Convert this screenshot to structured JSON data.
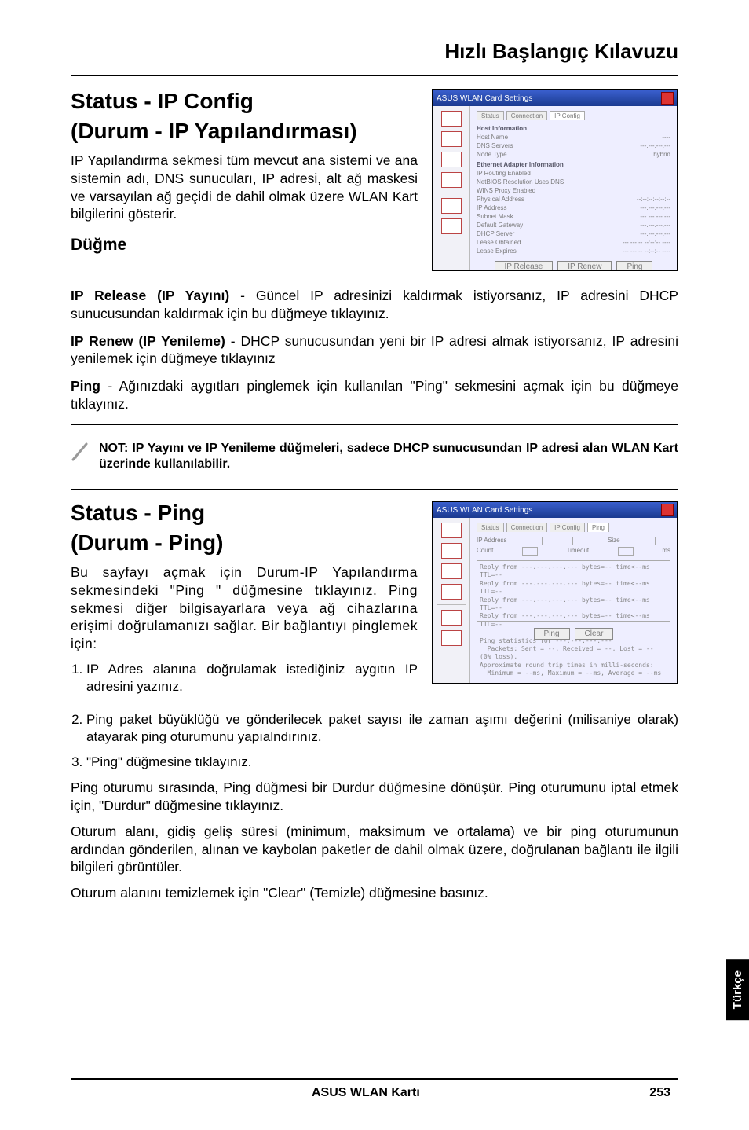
{
  "doc": {
    "header_title": "Hızlı Başlangıç Kılavuzu",
    "footer_product": "ASUS WLAN Kartı",
    "footer_page": "253",
    "side_lang_tab": "Türkçe"
  },
  "section1": {
    "title_line1": "Status - IP Config",
    "title_line2": "(Durum - IP Yapılandırması)",
    "intro": "IP Yapılandırma sekmesi tüm mevcut ana sistemi ve ana sistemin adı, DNS sunucuları, IP adresi, alt ağ maskesi ve varsayılan ağ geçidi de dahil olmak üzere WLAN Kart bilgilerini gösterir.",
    "buttons_heading": "Düğme",
    "b1_name": "IP Release (IP Yayını)",
    "b1_text": " - Güncel IP adresinizi kaldırmak istiyorsanız, IP adresini DHCP sunucusundan kaldırmak için bu düğmeye tıklayınız.",
    "b2_name": "IP Renew (IP Yenileme)",
    "b2_text": " - DHCP sunucusundan yeni bir IP adresi almak istiyorsanız, IP adresini yenilemek için düğmeye tıklayınız",
    "b3_name": "Ping",
    "b3_text": " - Ağınızdaki aygıtları pinglemek için kullanılan \"Ping\" sekmesini açmak için bu düğmeye tıklayınız.",
    "note": "NOT: IP Yayını ve IP Yenileme düğmeleri, sadece DHCP sunucusundan IP adresi alan WLAN Kart üzerinde kullanılabilir."
  },
  "section2": {
    "title_line1": "Status - Ping",
    "title_line2": "(Durum - Ping)",
    "intro": "Bu sayfayı açmak için Durum-IP Yapılandırma sekmesindeki \"Ping \" düğmesine tıklayınız. Ping sekmesi diğer bilgisayarlara veya ağ cihazlarına erişimi doğrulamanızı sağlar. Bir bağlantıyı pinglemek için:",
    "step1": "IP Adres alanına doğrulamak istediğiniz aygıtın IP adresini yazınız.",
    "step2": "Ping paket büyüklüğü ve gönderilecek paket sayısı ile zaman aşımı değerini (milisaniye olarak) atayarak ping oturumunu yapıalndırınız.",
    "step3": "\"Ping\" düğmesine tıklayınız.",
    "para1": "Ping oturumu sırasında, Ping düğmesi bir Durdur düğmesine dönüşür. Ping oturumunu iptal etmek için, \"Durdur\" düğmesine tıklayınız.",
    "para2": "Oturum alanı, gidiş geliş süresi (minimum, maksimum ve ortalama) ve bir ping oturumunun ardından gönderilen, alınan ve kaybolan paketler de dahil olmak üzere, doğrulanan bağlantı ile ilgili bilgileri görüntüler.",
    "para3": "Oturum alanını temizlemek için \"Clear\" (Temizle) düğmesine basınız."
  },
  "screenshot1": {
    "title": "ASUS WLAN Card Settings",
    "btn1": "IP Release",
    "btn2": "IP Renew",
    "btn3": "Ping"
  },
  "screenshot2": {
    "title": "ASUS WLAN Card Settings",
    "btn1": "Ping",
    "btn2": "Clear"
  }
}
